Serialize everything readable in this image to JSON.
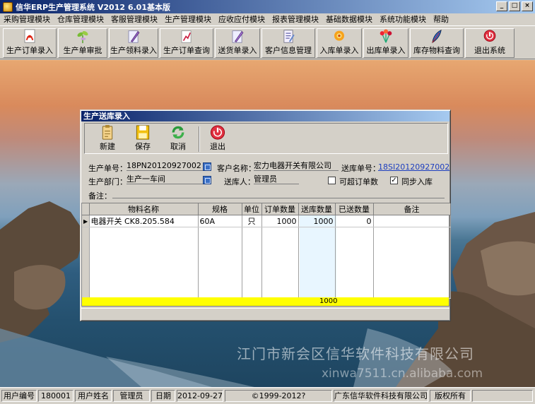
{
  "window": {
    "title": "信华ERP生产管理系统  V2012  6.01基本版"
  },
  "menu": [
    "采购管理模块",
    "仓库管理模块",
    "客服管理模块",
    "生产管理模块",
    "应收应付模块",
    "报表管理模块",
    "基础数据模块",
    "系统功能模块",
    "帮助"
  ],
  "toolbar": [
    {
      "label": "生产订单录入",
      "icon": "pdf-doc-icon"
    },
    {
      "label": "生产单审批",
      "icon": "plant-icon"
    },
    {
      "label": "生产领料录入",
      "icon": "pen-doc-icon"
    },
    {
      "label": "生产订单查询",
      "icon": "chart-doc-icon"
    },
    {
      "label": "送货单录入",
      "icon": "pen-doc-icon"
    },
    {
      "label": "客户信息管理",
      "icon": "note-icon"
    },
    {
      "label": "入库单录入",
      "icon": "flower-icon"
    },
    {
      "label": "出库单录入",
      "icon": "bouquet-icon"
    },
    {
      "label": "库存物料查询",
      "icon": "feather-icon"
    },
    {
      "label": "退出系统",
      "icon": "exit-icon"
    }
  ],
  "dialog": {
    "title": "生产送库录入",
    "toolbar": {
      "new": "新建",
      "save": "保存",
      "cancel": "取消",
      "exit": "退出"
    },
    "form": {
      "order_no_label": "生产单号：",
      "order_no": "18PN20120927002",
      "customer_label": "客户名称：",
      "customer": "宏力电器开关有限公司",
      "delivery_no_label": "送库单号：",
      "delivery_no": "18SI20120927002",
      "dept_label": "生产部门：",
      "dept": "生产一车间",
      "sender_label": "送库人：",
      "sender": "管理员",
      "exceed_label": "可超订单数",
      "exceed_checked": false,
      "sync_label": "同步入库",
      "sync_checked": true,
      "remark_label": "备注：",
      "remark": ""
    },
    "grid": {
      "columns": [
        "物料名称",
        "规格",
        "单位",
        "订单数量",
        "送库数量",
        "已送数量",
        "备注"
      ],
      "rows": [
        [
          "电器开关  CK8.205.584",
          "60A",
          "只",
          "1000",
          "1000",
          "0",
          ""
        ]
      ],
      "totals": {
        "delivery_qty": "1000"
      }
    }
  },
  "watermark": {
    "company": "江门市新会区信华软件科技有限公司",
    "site": "xinwa7511.cn.alibaba.com"
  },
  "status": {
    "user_id_label": "用户编号",
    "user_id": "180001",
    "user_name_label": "用户姓名",
    "user_name": "管理员",
    "date_label": "日期",
    "date": "2012-09-27",
    "copyright": "©1999-2012?",
    "company": "广东信华软件科技有限公司",
    "rights": "版权所有"
  }
}
